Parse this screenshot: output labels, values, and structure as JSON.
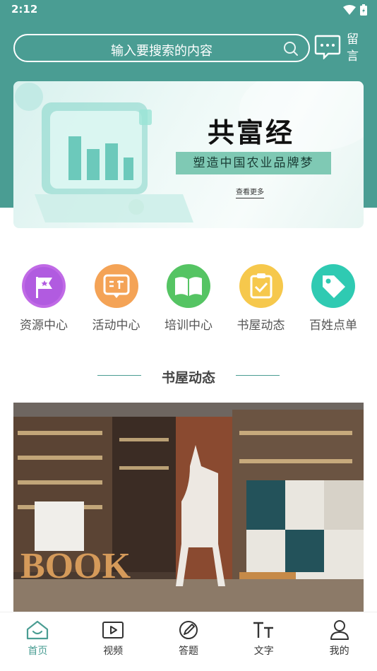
{
  "status_bar": {
    "time": "2:12"
  },
  "search": {
    "placeholder": "输入要搜索的内容"
  },
  "message": {
    "label": "留言"
  },
  "banner": {
    "title": "共富经",
    "subtitle": "塑造中国农业品牌梦",
    "more": "查看更多"
  },
  "quick_menu": [
    {
      "label": "资源中心",
      "icon": "flag-icon",
      "color": "#b85ee0"
    },
    {
      "label": "活动中心",
      "icon": "chat-icon",
      "color": "#f39a4a"
    },
    {
      "label": "培训中心",
      "icon": "book-icon",
      "color": "#4cbf5a"
    },
    {
      "label": "书屋动态",
      "icon": "clipboard-icon",
      "color": "#f5c142"
    },
    {
      "label": "百姓点单",
      "icon": "tag-icon",
      "color": "#2fc9b0"
    }
  ],
  "section": {
    "title": "书屋动态"
  },
  "photo": {
    "sign_text": "BOOK"
  },
  "tabbar": [
    {
      "label": "首页",
      "icon": "home-icon",
      "active": true
    },
    {
      "label": "视频",
      "icon": "video-icon",
      "active": false
    },
    {
      "label": "答题",
      "icon": "pencil-icon",
      "active": false
    },
    {
      "label": "文字",
      "icon": "text-icon",
      "active": false
    },
    {
      "label": "我的",
      "icon": "user-icon",
      "active": false
    }
  ],
  "colors": {
    "brand": "#4a9d93",
    "tab_active": "#4a9d93"
  }
}
